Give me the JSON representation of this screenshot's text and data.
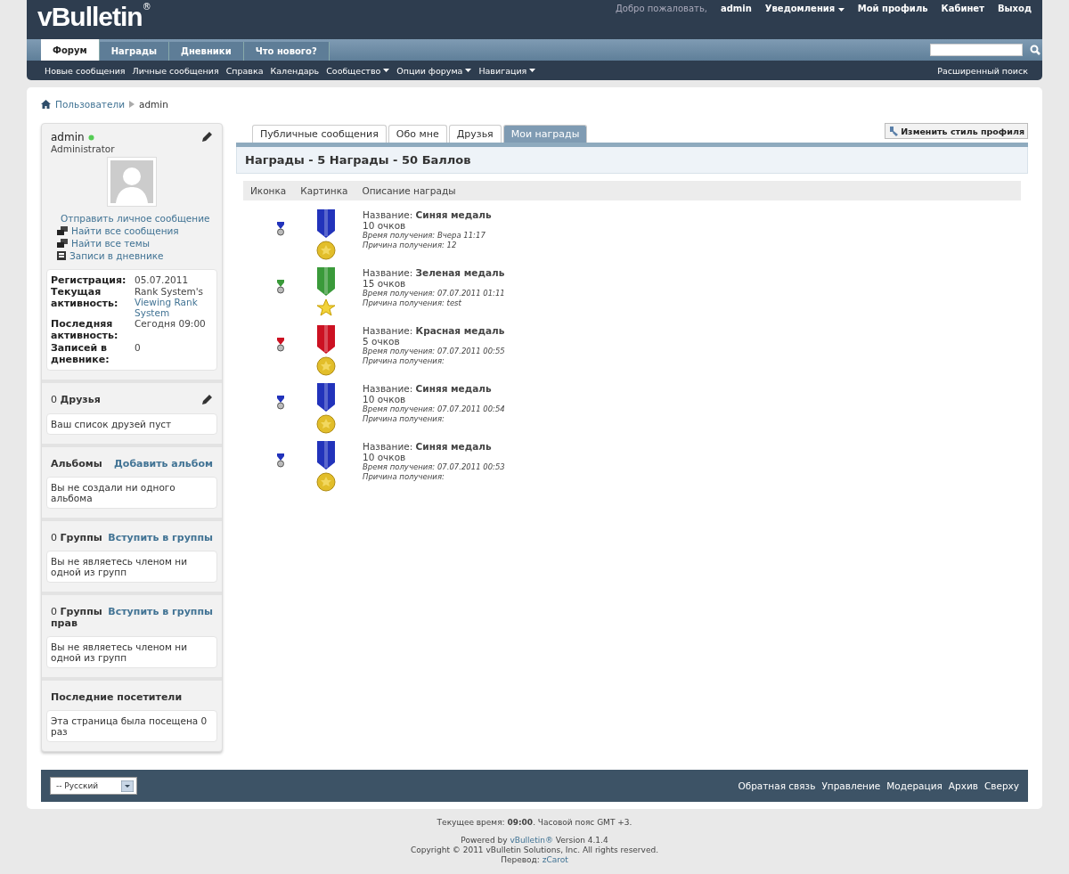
{
  "header": {
    "logo": "vBulletin",
    "logo_mark": "®",
    "welcome": "Добро пожаловать,",
    "user": "admin",
    "links": [
      {
        "label": "Уведомления",
        "dropdown": true
      },
      {
        "label": "Мой профиль",
        "dropdown": false
      },
      {
        "label": "Кабинет",
        "dropdown": false
      },
      {
        "label": "Выход",
        "dropdown": false
      }
    ]
  },
  "nav_tabs": [
    {
      "label": "Форум",
      "selected": true
    },
    {
      "label": "Награды",
      "selected": false
    },
    {
      "label": "Дневники",
      "selected": false
    },
    {
      "label": "Что нового?",
      "selected": false
    }
  ],
  "subnav": {
    "items": [
      {
        "label": "Новые сообщения",
        "dropdown": false
      },
      {
        "label": "Личные сообщения",
        "dropdown": false
      },
      {
        "label": "Справка",
        "dropdown": false
      },
      {
        "label": "Календарь",
        "dropdown": false
      },
      {
        "label": "Сообщество",
        "dropdown": true
      },
      {
        "label": "Опции форума",
        "dropdown": true
      },
      {
        "label": "Навигация",
        "dropdown": true
      }
    ],
    "advanced_search": "Расширенный поиск"
  },
  "breadcrumb": [
    "Пользователи",
    "admin"
  ],
  "profile": {
    "name": "admin",
    "online": true,
    "title": "Administrator",
    "links": [
      {
        "label": "Отправить личное сообщение",
        "kind": "mail"
      },
      {
        "label": "Найти все сообщения",
        "kind": "posts"
      },
      {
        "label": "Найти все темы",
        "kind": "posts"
      },
      {
        "label": "Записи в дневнике",
        "kind": "diary"
      }
    ],
    "stats": [
      {
        "label": "Регистрация:",
        "value": "05.07.2011"
      },
      {
        "label": "Текущая активность:",
        "value": "Rank System's",
        "link": "Viewing Rank System"
      },
      {
        "label": "Последняя активность:",
        "value": "Сегодня 09:00"
      },
      {
        "label": "Записей в дневнике:",
        "value": "0"
      }
    ]
  },
  "side_blocks": [
    {
      "title": "0 **Друзья**",
      "edit": true,
      "body": "Ваш список друзей пуст"
    },
    {
      "title": "**Альбомы**",
      "action": "Добавить альбом",
      "body": "Вы не создали ни одного альбома"
    },
    {
      "title": "0 **Группы**",
      "action": "Вступить в группы",
      "body": "Вы не являетесь членом ни одной из групп"
    },
    {
      "title": "0 **Группы прав**",
      "action": "Вступить в группы",
      "body": "Вы не являетесь членом ни одной из групп"
    },
    {
      "title": "**Последние посетители**",
      "body": "Эта страница была посещена 0 раз"
    }
  ],
  "profile_tabs": [
    {
      "label": "Публичные сообщения",
      "selected": false
    },
    {
      "label": "Обо мне",
      "selected": false
    },
    {
      "label": "Друзья",
      "selected": false
    },
    {
      "label": "Мои награды",
      "selected": true
    }
  ],
  "change_style": "Изменить стиль профиля",
  "awards_title": "Награды - 5 Награды - 50 Баллов",
  "columns": [
    "Иконка",
    "Картинка",
    "Описание награды"
  ],
  "awards": [
    {
      "color": "#2233bb",
      "kind": "coin",
      "name_label": "Название:",
      "name": "Синяя медаль",
      "points": "10 очков",
      "time": "Время получения: Вчера 11:17",
      "reason": "Причина получения: 12"
    },
    {
      "color": "#3a9a3a",
      "kind": "star",
      "name_label": "Название:",
      "name": "Зеленая медаль",
      "points": "15 очков",
      "time": "Время получения: 07.07.2011 01:11",
      "reason": "Причина получения: test"
    },
    {
      "color": "#cc1122",
      "kind": "coin",
      "name_label": "Название:",
      "name": "Красная медаль",
      "points": "5 очков",
      "time": "Время получения: 07.07.2011 00:55",
      "reason": "Причина получения:"
    },
    {
      "color": "#2233bb",
      "kind": "coin",
      "name_label": "Название:",
      "name": "Синяя медаль",
      "points": "10 очков",
      "time": "Время получения: 07.07.2011 00:54",
      "reason": "Причина получения:"
    },
    {
      "color": "#2233bb",
      "kind": "coin",
      "name_label": "Название:",
      "name": "Синяя медаль",
      "points": "10 очков",
      "time": "Время получения: 07.07.2011 00:53",
      "reason": "Причина получения:"
    }
  ],
  "footer": {
    "language": "-- Русский",
    "links": [
      "Обратная связь",
      "Управление",
      "Модерация",
      "Архив",
      "Сверху"
    ]
  },
  "bottom": {
    "time": "Текущее время: **09:00**. Часовой пояс GMT +3.",
    "powered_prefix": "Powered by",
    "powered_link": "vBulletin®",
    "powered_suffix": "Version 4.1.4",
    "copyright": "Copyright © 2011 vBulletin Solutions, Inc. All rights reserved.",
    "translation_prefix": "Перевод:",
    "translation_link": "zCarot"
  }
}
